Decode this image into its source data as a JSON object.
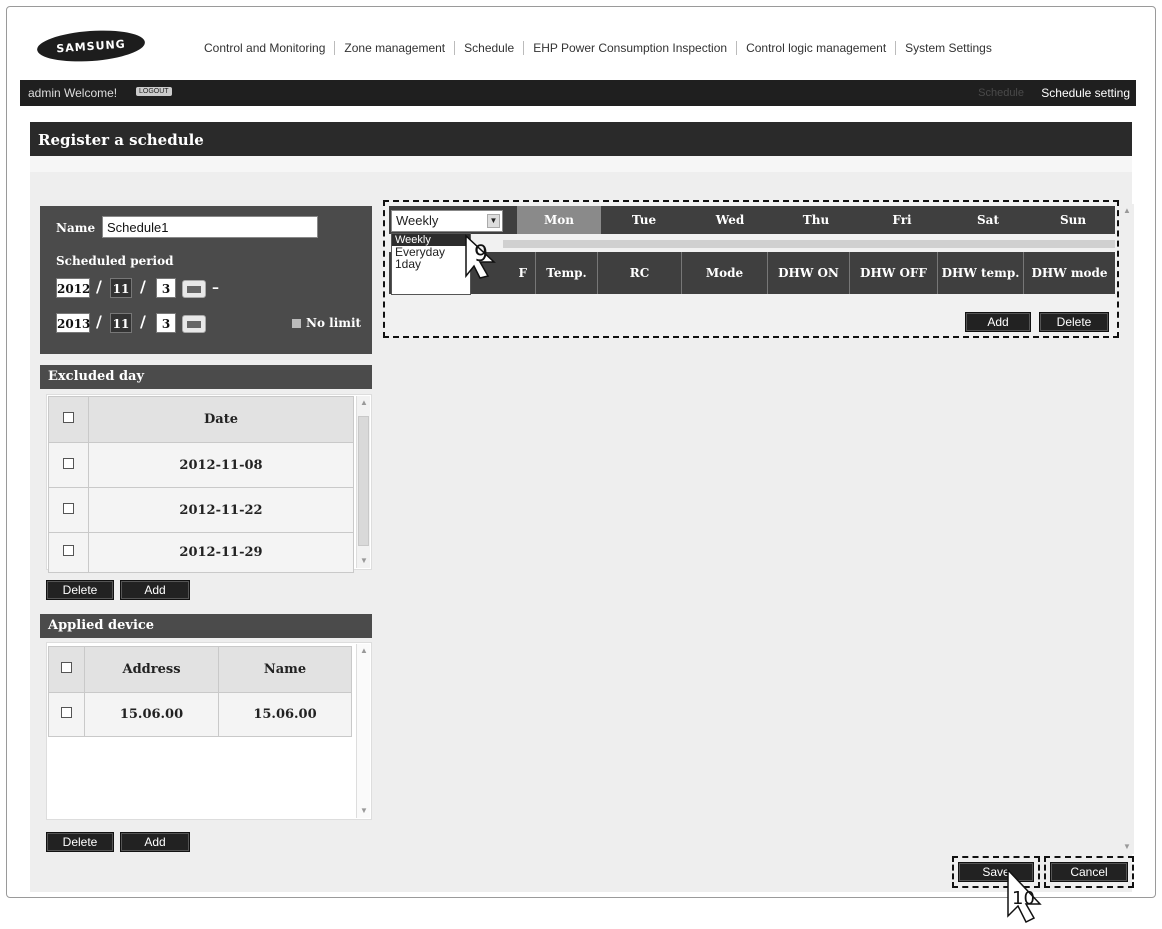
{
  "app": {
    "logo": "SAMSUNG",
    "nav": [
      "Control and Monitoring",
      "Zone management",
      "Schedule",
      "EHP Power Consumption Inspection",
      "Control logic management",
      "System Settings"
    ]
  },
  "userbar": {
    "welcome": "admin Welcome!",
    "logout": "LOGOUT",
    "breadcrumb_prev": "Schedule",
    "breadcrumb_current": "Schedule setting"
  },
  "page_title": "Register a schedule",
  "schedule_form": {
    "name_label": "Name",
    "name_value": "Schedule1",
    "period_label": "Scheduled period",
    "start": {
      "year": "2012",
      "month": "11",
      "day": "3"
    },
    "end": {
      "year": "2013",
      "month": "11",
      "day": "3"
    },
    "separator": "/",
    "dash": "–",
    "no_limit_label": "No limit"
  },
  "excluded_day": {
    "title": "Excluded day",
    "header": "Date",
    "rows": [
      "2012-11-08",
      "2012-11-22",
      "2012-11-29"
    ],
    "delete_label": "Delete",
    "add_label": "Add"
  },
  "applied_device": {
    "title": "Applied device",
    "headers": [
      "Address",
      "Name"
    ],
    "rows": [
      {
        "address": "15.06.00",
        "name": "15.06.00"
      }
    ],
    "delete_label": "Delete",
    "add_label": "Add"
  },
  "schedule_table": {
    "repeat_select": "Weekly",
    "repeat_options": [
      "Weekly",
      "Everyday",
      "1day"
    ],
    "days": [
      "Mon",
      "Tue",
      "Wed",
      "Thu",
      "Fri",
      "Sat",
      "Sun"
    ],
    "selected_day": "Mon",
    "columns": [
      "F",
      "Temp.",
      "RC",
      "Mode",
      "DHW ON",
      "DHW OFF",
      "DHW temp.",
      "DHW mode"
    ],
    "add_label": "Add",
    "delete_label": "Delete"
  },
  "footer": {
    "save_label": "Save",
    "cancel_label": "Cancel"
  },
  "callouts": [
    "9",
    "10"
  ]
}
